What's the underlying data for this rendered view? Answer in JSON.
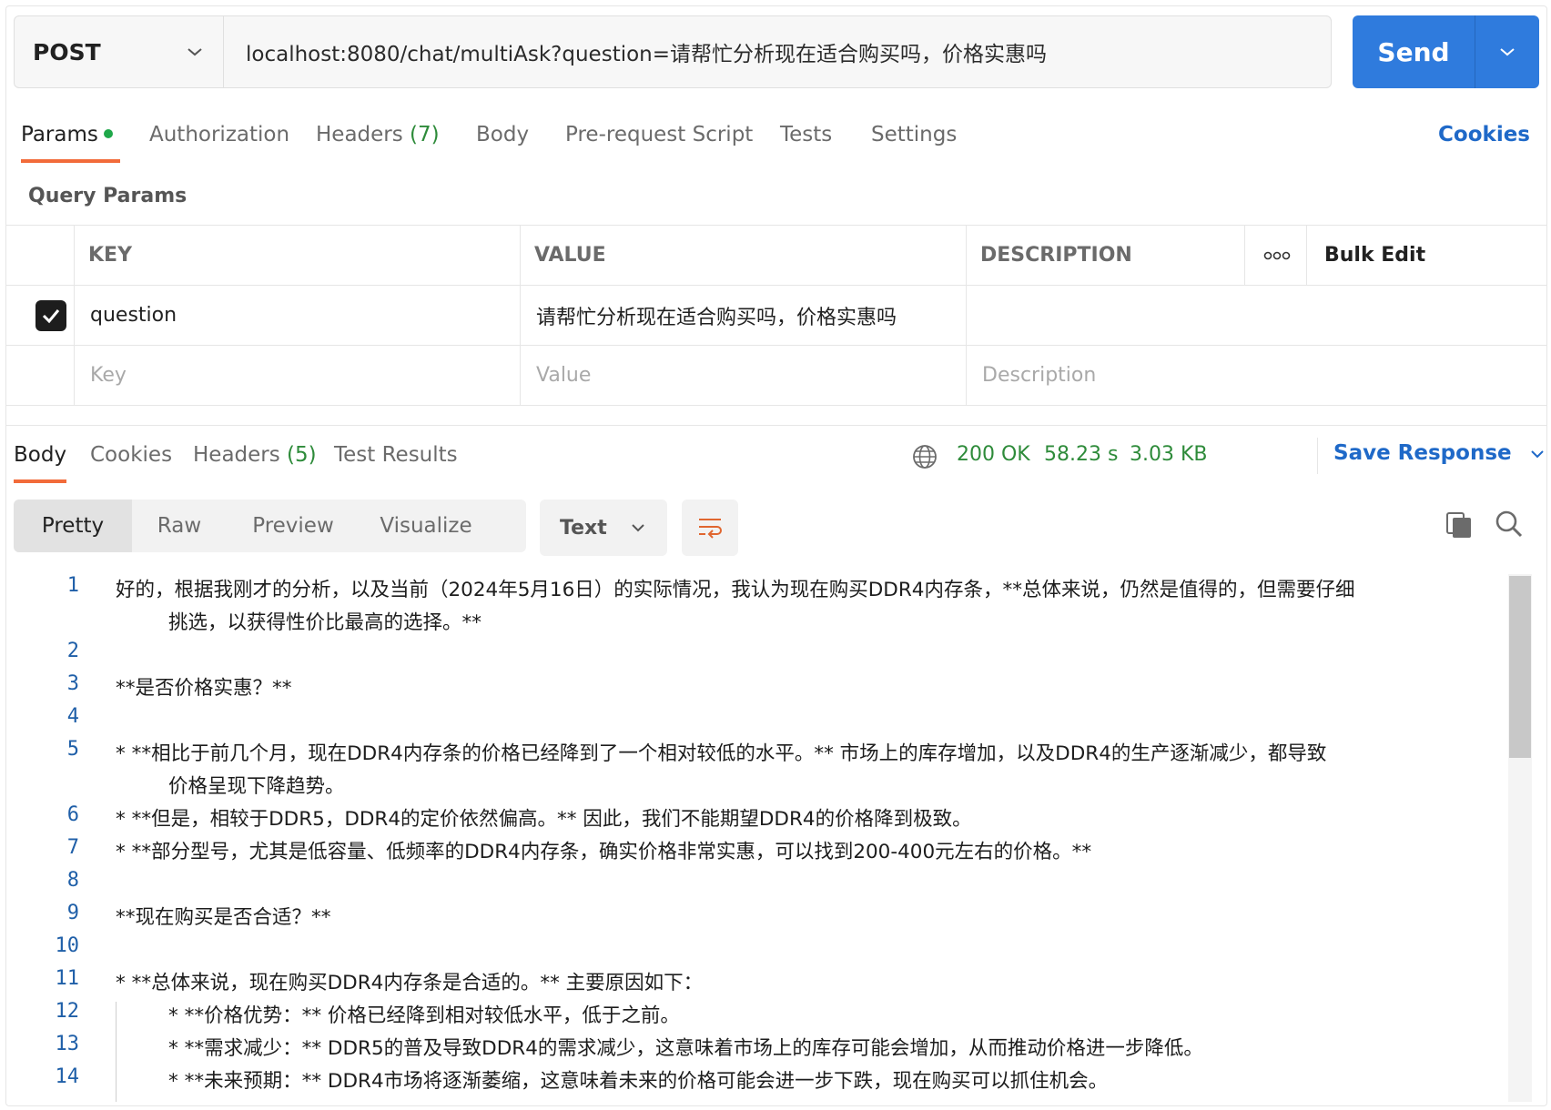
{
  "request": {
    "method": "POST",
    "url": "localhost:8080/chat/multiAsk?question=请帮忙分析现在适合购买吗，价格实惠吗",
    "send_label": "Send"
  },
  "request_tabs": {
    "params": "Params",
    "authorization": "Authorization",
    "headers": "Headers",
    "headers_count": "(7)",
    "body": "Body",
    "pre_request": "Pre-request Script",
    "tests": "Tests",
    "settings": "Settings",
    "cookies": "Cookies"
  },
  "query_params": {
    "title": "Query Params",
    "headers": {
      "key": "KEY",
      "value": "VALUE",
      "description": "DESCRIPTION",
      "bulk_edit": "Bulk Edit"
    },
    "rows": [
      {
        "checked": true,
        "key": "question",
        "value": "请帮忙分析现在适合购买吗，价格实惠吗",
        "description": ""
      }
    ],
    "placeholders": {
      "key": "Key",
      "value": "Value",
      "description": "Description"
    }
  },
  "response_tabs": {
    "body": "Body",
    "cookies": "Cookies",
    "headers": "Headers",
    "headers_count": "(5)",
    "test_results": "Test Results",
    "status": "200 OK",
    "time": "58.23 s",
    "size": "3.03 KB",
    "save_response": "Save Response"
  },
  "view_modes": {
    "pretty": "Pretty",
    "raw": "Raw",
    "preview": "Preview",
    "visualize": "Visualize",
    "format": "Text"
  },
  "code_lines": [
    {
      "n": "1",
      "t": "好的，根据我刚才的分析，以及当前（2024年5月16日）的实际情况，我认为现在购买DDR4内存条，**总体来说，仍然是值得的，但需要仔细"
    },
    {
      "n": "",
      "t": "挑选，以获得性价比最高的选择。**"
    },
    {
      "n": "2",
      "t": ""
    },
    {
      "n": "3",
      "t": "**是否价格实惠？**"
    },
    {
      "n": "4",
      "t": ""
    },
    {
      "n": "5",
      "t": "*   **相比于前几个月，现在DDR4内存条的价格已经降到了一个相对较低的水平。** 市场上的库存增加，以及DDR4的生产逐渐减少，都导致"
    },
    {
      "n": "",
      "t": "价格呈现下降趋势。"
    },
    {
      "n": "6",
      "t": "*   **但是，相较于DDR5，DDR4的定价依然偏高。**  因此，我们不能期望DDR4的价格降到极致。"
    },
    {
      "n": "7",
      "t": "*   **部分型号，尤其是低容量、低频率的DDR4内存条，确实价格非常实惠，可以找到200-400元左右的价格。**"
    },
    {
      "n": "8",
      "t": ""
    },
    {
      "n": "9",
      "t": "**现在购买是否合适？**"
    },
    {
      "n": "10",
      "t": ""
    },
    {
      "n": "11",
      "t": "*   **总体来说，现在购买DDR4内存条是合适的。** 主要原因如下："
    },
    {
      "n": "12",
      "t": "*   **价格优势：**  价格已经降到相对较低水平，低于之前。"
    },
    {
      "n": "13",
      "t": "*   **需求减少：**  DDR5的普及导致DDR4的需求减少，这意味着市场上的库存可能会增加，从而推动价格进一步降低。"
    },
    {
      "n": "14",
      "t": "*   **未来预期：**  DDR4市场将逐渐萎缩，这意味着未来的价格可能会进一步下跌，现在购买可以抓住机会。"
    }
  ]
}
